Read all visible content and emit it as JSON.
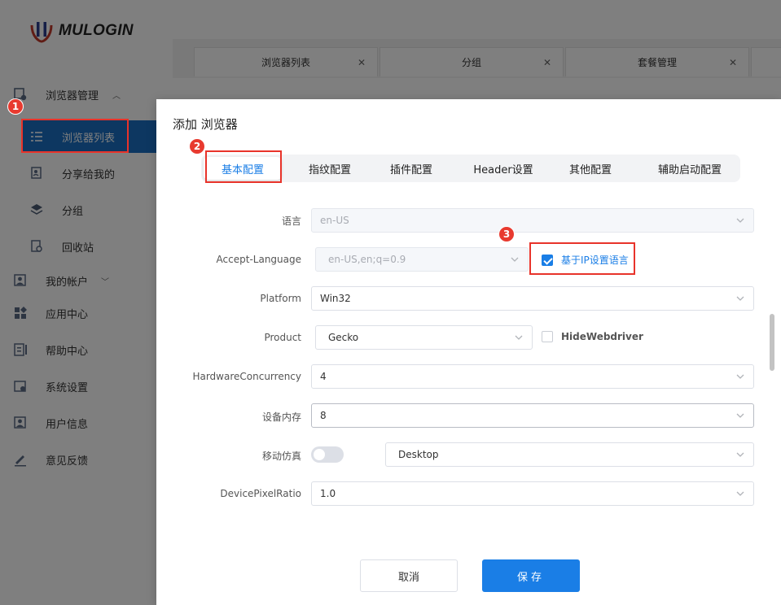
{
  "brand": {
    "logo_text": "MULOGIN"
  },
  "sidebar": {
    "items": [
      {
        "label": "浏览器管理",
        "icon": "browser-manage-icon"
      },
      {
        "label": "浏览器列表",
        "icon": "list-icon"
      },
      {
        "label": "分享给我的",
        "icon": "share-icon"
      },
      {
        "label": "分组",
        "icon": "layers-icon"
      },
      {
        "label": "回收站",
        "icon": "recycle-icon"
      },
      {
        "label": "我的帐户",
        "icon": "account-icon"
      },
      {
        "label": "应用中心",
        "icon": "apps-icon"
      },
      {
        "label": "帮助中心",
        "icon": "help-icon"
      },
      {
        "label": "系统设置",
        "icon": "settings-icon"
      },
      {
        "label": "用户信息",
        "icon": "user-info-icon"
      },
      {
        "label": "意见反馈",
        "icon": "feedback-icon"
      }
    ]
  },
  "top_tabs": [
    {
      "label": "浏览器列表"
    },
    {
      "label": "分组"
    },
    {
      "label": "套餐管理"
    }
  ],
  "annotations": {
    "b1": "1",
    "b2": "2",
    "b3": "3"
  },
  "modal": {
    "title": "添加 浏览器",
    "tabs": [
      {
        "label": "基本配置"
      },
      {
        "label": "指纹配置"
      },
      {
        "label": "插件配置"
      },
      {
        "label": "Header设置"
      },
      {
        "label": "其他配置"
      },
      {
        "label": "辅助启动配置"
      }
    ],
    "active_tab": "基本配置",
    "fields": {
      "language": {
        "label": "语言",
        "value": "en-US"
      },
      "accept_language": {
        "label": "Accept-Language",
        "value": "en-US,en;q=0.9",
        "checkbox_label": "基于IP设置语言",
        "checked": true
      },
      "platform": {
        "label": "Platform",
        "value": "Win32"
      },
      "product": {
        "label": "Product",
        "value": "Gecko",
        "checkbox_label": "HideWebdriver",
        "checked": false
      },
      "hardware": {
        "label": "HardwareConcurrency",
        "value": "4"
      },
      "memory": {
        "label": "设备内存",
        "value": "8"
      },
      "mobile": {
        "label": "移动仿真",
        "enabled": false,
        "value": "Desktop"
      },
      "dpr": {
        "label": "DevicePixelRatio",
        "value": "1.0"
      }
    },
    "buttons": {
      "cancel": "取消",
      "save": "保存"
    }
  },
  "colors": {
    "accent": "#1a7ee6",
    "highlight": "#e8332a",
    "sidebar_active": "#1a6fc2"
  }
}
